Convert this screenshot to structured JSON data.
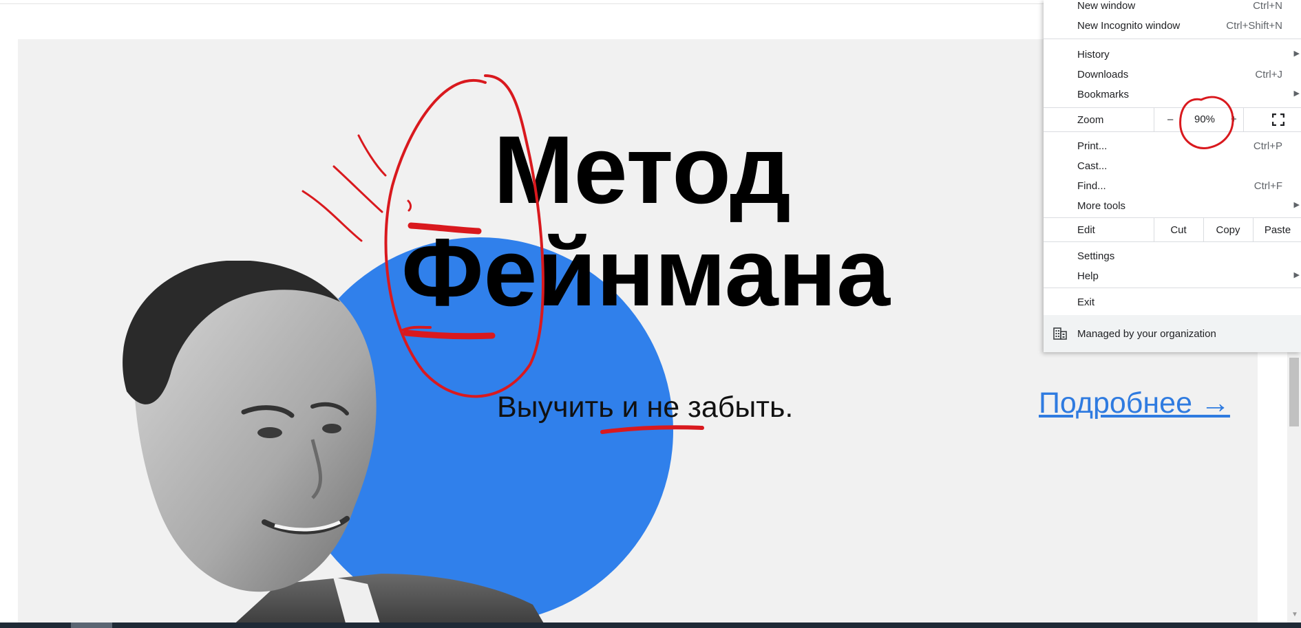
{
  "hero": {
    "title_line1": "Метод",
    "title_line2": "Фейнмана",
    "subtitle": "Выучить и не забыть.",
    "more_link": "Подробнее →",
    "accent_color": "#3080eb",
    "link_color": "#2f7be0"
  },
  "menu": {
    "new_window": {
      "label": "New window",
      "shortcut": "Ctrl+N"
    },
    "new_incognito": {
      "label": "New Incognito window",
      "shortcut": "Ctrl+Shift+N"
    },
    "history": {
      "label": "History"
    },
    "downloads": {
      "label": "Downloads",
      "shortcut": "Ctrl+J"
    },
    "bookmarks": {
      "label": "Bookmarks"
    },
    "zoom": {
      "label": "Zoom",
      "minus": "–",
      "value": "90%",
      "plus": "+"
    },
    "print": {
      "label": "Print...",
      "shortcut": "Ctrl+P"
    },
    "cast": {
      "label": "Cast..."
    },
    "find": {
      "label": "Find...",
      "shortcut": "Ctrl+F"
    },
    "more_tools": {
      "label": "More tools"
    },
    "edit": {
      "label": "Edit",
      "cut": "Cut",
      "copy": "Copy",
      "paste": "Paste"
    },
    "settings": {
      "label": "Settings"
    },
    "help": {
      "label": "Help"
    },
    "exit": {
      "label": "Exit"
    },
    "managed": {
      "label": "Managed by your organization",
      "icon": "building-icon"
    }
  },
  "annotation_color": "#d9191e"
}
